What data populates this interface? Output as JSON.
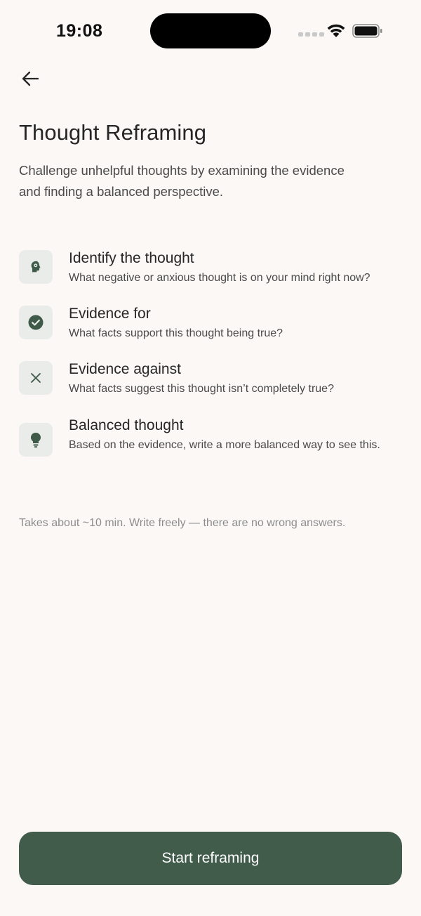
{
  "status_bar": {
    "time": "19:08"
  },
  "header": {
    "back_icon": "arrow-left-icon",
    "title": "Thought Reframing",
    "subtitle": "Challenge unhelpful thoughts by examining the evidence and finding a balanced perspective."
  },
  "steps": [
    {
      "icon": "head-gear-icon",
      "title": "Identify the thought",
      "description": "What negative or anxious thought is on your mind right now?"
    },
    {
      "icon": "check-circle-icon",
      "title": "Evidence for",
      "description": "What facts support this thought being true?"
    },
    {
      "icon": "close-icon",
      "title": "Evidence against",
      "description": "What facts suggest this thought isn’t completely true?"
    },
    {
      "icon": "lightbulb-icon",
      "title": "Balanced thought",
      "description": "Based on the evidence, write a more balanced way to see this."
    }
  ],
  "footnote": "Takes about ~10 min. Write freely — there are no wrong answers.",
  "cta": {
    "label": "Start reframing"
  },
  "colors": {
    "background": "#fbf8f6",
    "accent": "#415c4b",
    "icon_tile": "#eaecea",
    "muted_text": "#8d8d8d"
  }
}
